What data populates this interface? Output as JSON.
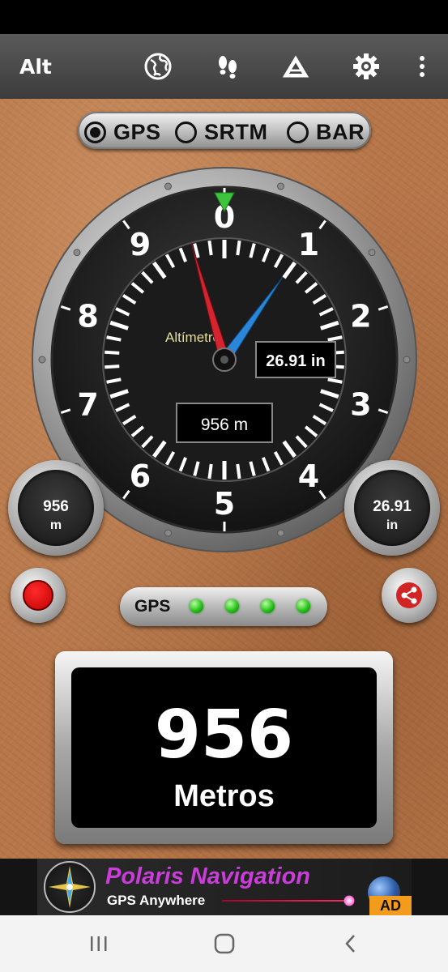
{
  "app_bar": {
    "title": "Alt",
    "icons": [
      "globe-icon",
      "footprints-icon",
      "mountain-icon",
      "gear-icon",
      "more-vert-icon"
    ]
  },
  "source_selector": {
    "options": [
      {
        "label": "GPS",
        "selected": true
      },
      {
        "label": "SRTM",
        "selected": false
      },
      {
        "label": "BAR",
        "selected": false
      }
    ]
  },
  "altimeter": {
    "dial_numbers": [
      "0",
      "1",
      "2",
      "3",
      "4",
      "5",
      "6",
      "7",
      "8",
      "9"
    ],
    "brand": "Altímetro",
    "pressure_window": "26.91 in",
    "altitude_window": "956 m"
  },
  "left_gauge": {
    "value": "956",
    "unit": "m"
  },
  "right_gauge": {
    "value": "26.91",
    "unit": "in"
  },
  "gps_status": {
    "label": "GPS",
    "leds_on": 4,
    "led_color": "#2ac21e"
  },
  "display": {
    "value": "956",
    "unit": "Metros"
  },
  "ad": {
    "title": "Polaris Navigation",
    "subtitle": "GPS Anywhere",
    "badge": "AD"
  },
  "colors": {
    "leather": "#b7774a",
    "needle_long": "#d4242f",
    "needle_short": "#2a86d9",
    "marker": "#3cc43c",
    "brand_text": "#e6de9c"
  }
}
